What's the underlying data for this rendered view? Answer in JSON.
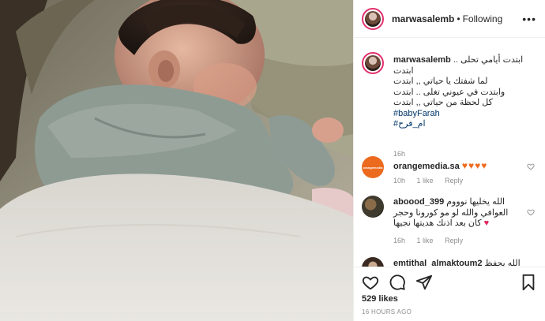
{
  "post": {
    "username": "marwasalemb",
    "separator": "•",
    "follow_status": "Following",
    "more_label": "•••"
  },
  "caption": {
    "username": "marwasalemb",
    "lines": [
      "ابتدت أيامي تحلى .. ابتدت",
      "لما شفتك يا حياتي ,, ابتدت",
      "وابتدت في عيوني تغلى .. ابتدت",
      "كل لحظة من حياتي ,, ابتدت"
    ],
    "tags": [
      "#babyFarah",
      "#ام_فرح"
    ],
    "time": "16h"
  },
  "comments": [
    {
      "username": "orangemedia.sa",
      "text": "♥♥♥♥",
      "time": "10h",
      "likes": "1 like",
      "reply": "Reply",
      "avatar_text": "orangemedia"
    },
    {
      "username": "aboood_399",
      "text": "الله يخليها نوووم العوافي والله لو مو كورونا وحجر كان بعد اذنك هديتها نجيها",
      "heart": "♥",
      "time": "16h",
      "likes": "1 like",
      "reply": "Reply"
    },
    {
      "username": "emtithal_almaktoum2",
      "text": "الله يحفظ"
    }
  ],
  "footer": {
    "likes": "529 likes",
    "ago": "16 HOURS AGO"
  },
  "colors": {
    "accent_ring": "#e1306c",
    "link": "#00376b",
    "hearts": "#ed6c1f",
    "muted": "#8e8e8e"
  },
  "icons": [
    "heart-icon",
    "comment-icon",
    "share-icon",
    "bookmark-icon",
    "more-icon"
  ]
}
